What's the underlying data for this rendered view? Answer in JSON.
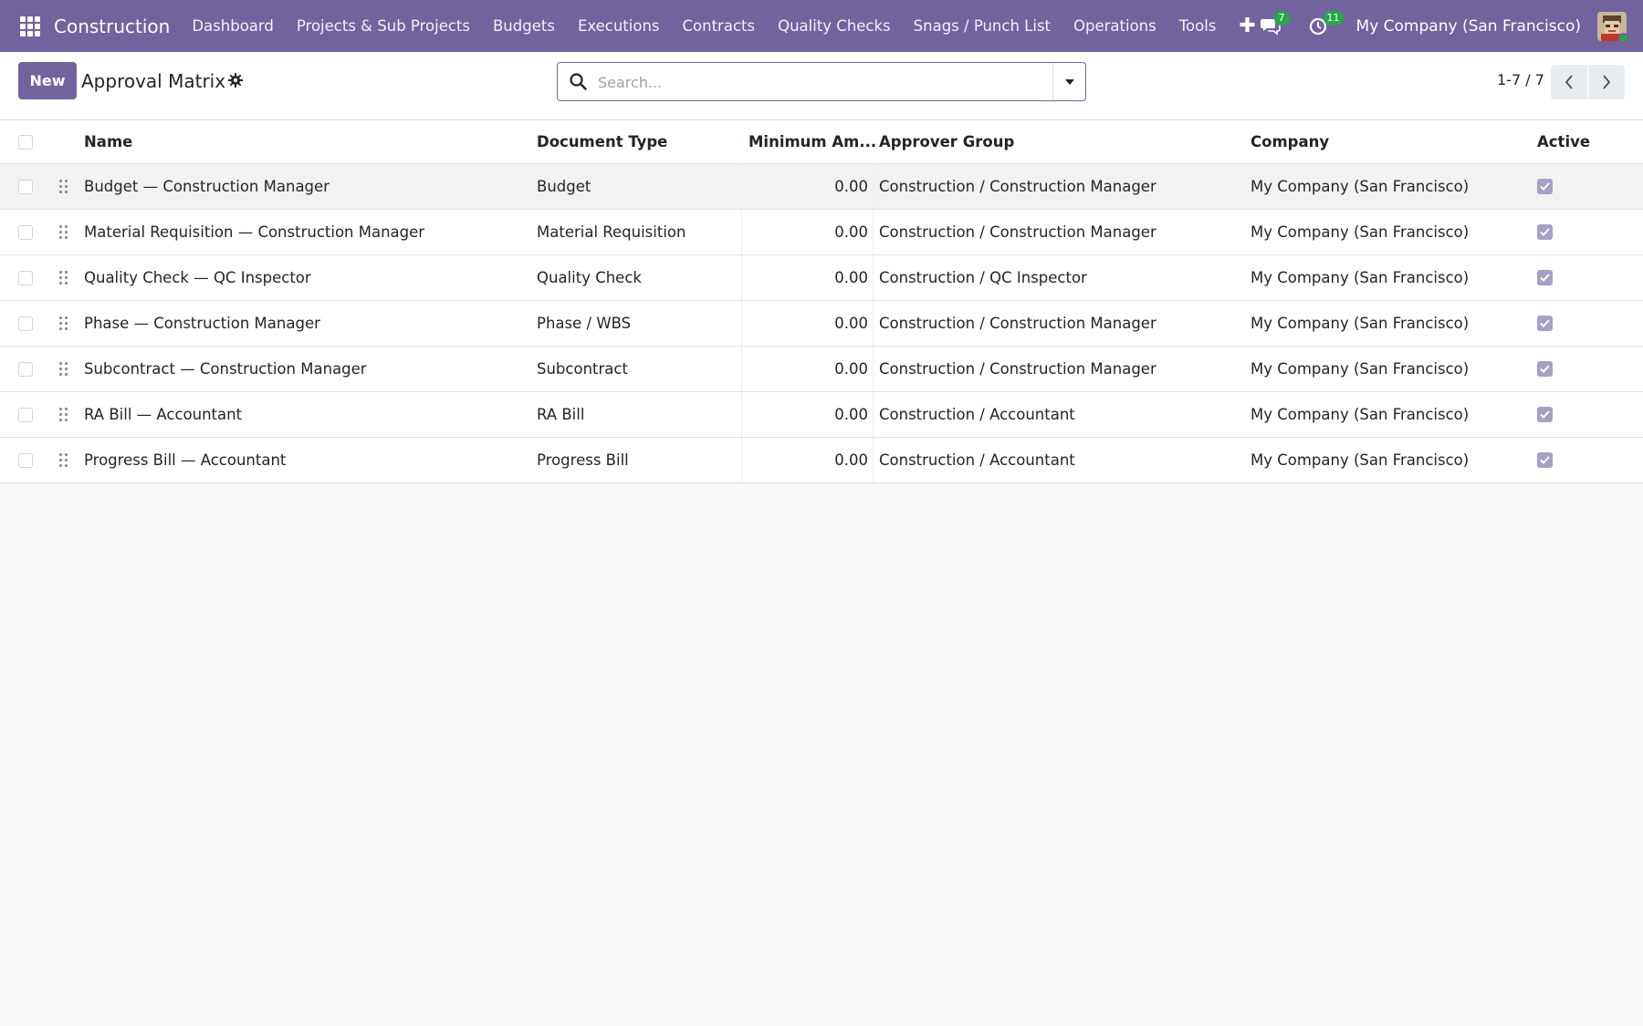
{
  "app": {
    "brand": "Construction",
    "menu": [
      "Dashboard",
      "Projects & Sub Projects",
      "Budgets",
      "Executions",
      "Contracts",
      "Quality Checks",
      "Snags / Punch List",
      "Operations",
      "Tools"
    ],
    "messages_count": "7",
    "activities_count": "11",
    "company": "My Company (San Francisco)",
    "accent_color": "#71639e"
  },
  "control_panel": {
    "new_label": "New",
    "title": "Approval Matrix",
    "search_placeholder": "Search...",
    "pager": "1-7 / 7"
  },
  "table": {
    "columns": [
      "Name",
      "Document Type",
      "Minimum Am...",
      "Approver Group",
      "Company",
      "Active"
    ],
    "rows": [
      {
        "name": "Budget — Construction Manager",
        "doctype": "Budget",
        "amount": "0.00",
        "group": "Construction / Construction Manager",
        "company": "My Company (San Francisco)",
        "active": true
      },
      {
        "name": "Material Requisition — Construction Manager",
        "doctype": "Material Requisition",
        "amount": "0.00",
        "group": "Construction / Construction Manager",
        "company": "My Company (San Francisco)",
        "active": true
      },
      {
        "name": "Quality Check — QC Inspector",
        "doctype": "Quality Check",
        "amount": "0.00",
        "group": "Construction / QC Inspector",
        "company": "My Company (San Francisco)",
        "active": true
      },
      {
        "name": "Phase — Construction Manager",
        "doctype": "Phase / WBS",
        "amount": "0.00",
        "group": "Construction / Construction Manager",
        "company": "My Company (San Francisco)",
        "active": true
      },
      {
        "name": "Subcontract — Construction Manager",
        "doctype": "Subcontract",
        "amount": "0.00",
        "group": "Construction / Construction Manager",
        "company": "My Company (San Francisco)",
        "active": true
      },
      {
        "name": "RA Bill — Accountant",
        "doctype": "RA Bill",
        "amount": "0.00",
        "group": "Construction / Accountant",
        "company": "My Company (San Francisco)",
        "active": true
      },
      {
        "name": "Progress Bill — Accountant",
        "doctype": "Progress Bill",
        "amount": "0.00",
        "group": "Construction / Accountant",
        "company": "My Company (San Francisco)",
        "active": true
      }
    ]
  }
}
